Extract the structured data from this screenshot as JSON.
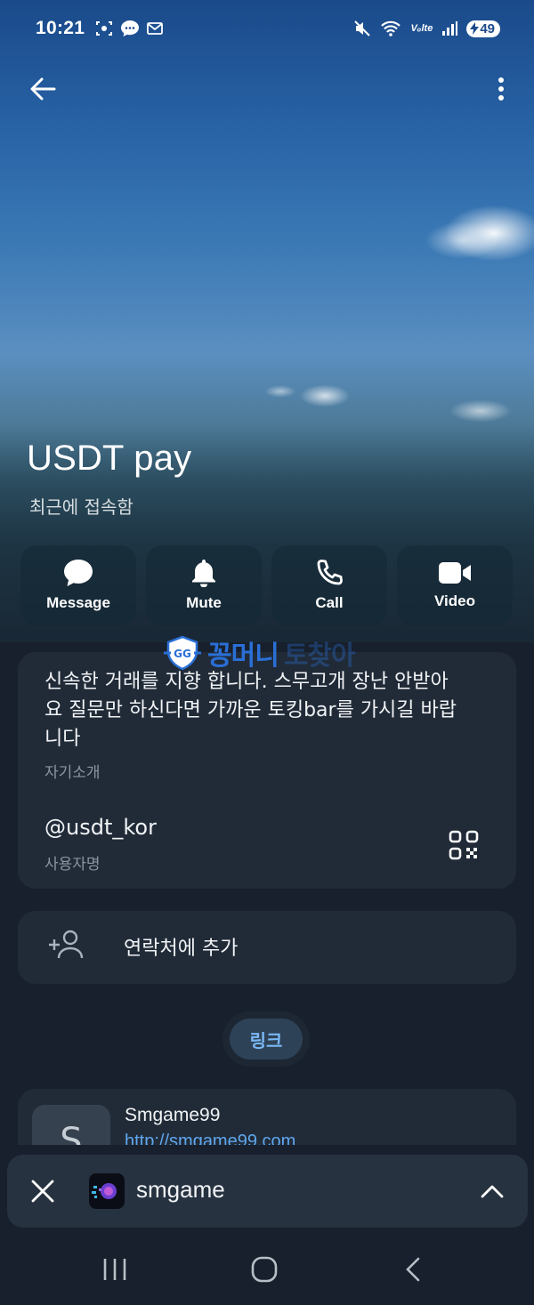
{
  "status_bar": {
    "time": "10:21",
    "network": "Vₒlte",
    "battery": "49"
  },
  "profile": {
    "name": "USDT pay",
    "last_seen": "최근에 접속함"
  },
  "actions": [
    {
      "label": "Message",
      "icon": "message-icon"
    },
    {
      "label": "Mute",
      "icon": "bell-icon"
    },
    {
      "label": "Call",
      "icon": "phone-icon"
    },
    {
      "label": "Video",
      "icon": "video-icon"
    }
  ],
  "watermark": {
    "text": "꽁머니",
    "text_faint": "토찾아"
  },
  "bio": {
    "text": "신속한 거래를 지향 합니다. 스무고개 장난 안받아요 질문만 하신다면 가까운 토킹bar를 가시길 바랍니다",
    "label": "자기소개",
    "username": "@usdt_kor",
    "username_label": "사용자명"
  },
  "add_contact": {
    "label": "연락처에 추가"
  },
  "links_tab": {
    "label": "링크"
  },
  "link_item": {
    "thumb_letter": "S",
    "title": "Smgame99",
    "url": "http://smgame99.com"
  },
  "mini_player": {
    "title": "smgame"
  },
  "colors": {
    "accent": "#5fa7ee",
    "card_bg": "#212b38",
    "page_bg": "#17202c"
  }
}
